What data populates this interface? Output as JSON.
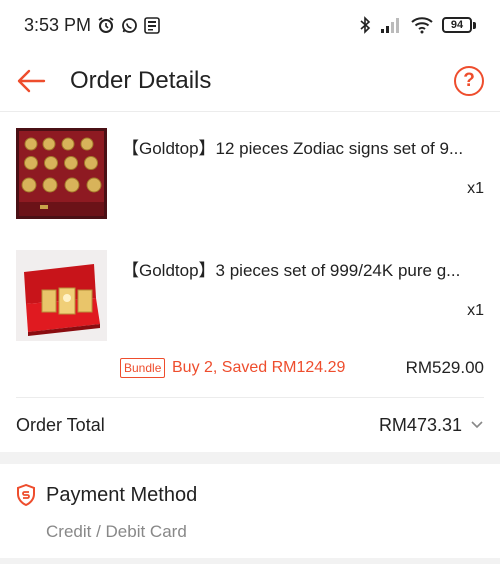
{
  "status_bar": {
    "time": "3:53 PM",
    "battery": "94",
    "icons": [
      "alarm-icon",
      "whatsapp-icon",
      "app-notification-icon",
      "bluetooth-icon",
      "signal-icon",
      "wifi-icon",
      "battery-icon"
    ]
  },
  "header": {
    "title": "Order Details",
    "help": "?"
  },
  "items": [
    {
      "title": "【Goldtop】12 pieces Zodiac signs set of 9...",
      "qty": "x1",
      "image": "zodiac-coin-set-image"
    },
    {
      "title": "【Goldtop】3 pieces set of 999/24K pure g...",
      "qty": "x1",
      "image": "gold-bar-set-image"
    }
  ],
  "bundle": {
    "tag": "Bundle",
    "text": "Buy 2, Saved RM124.29",
    "price": "RM529.00"
  },
  "order_total": {
    "label": "Order Total",
    "value": "RM473.31"
  },
  "payment": {
    "title": "Payment Method",
    "method": "Credit / Debit Card"
  },
  "colors": {
    "accent": "#ee4d2d",
    "muted": "#888888"
  }
}
